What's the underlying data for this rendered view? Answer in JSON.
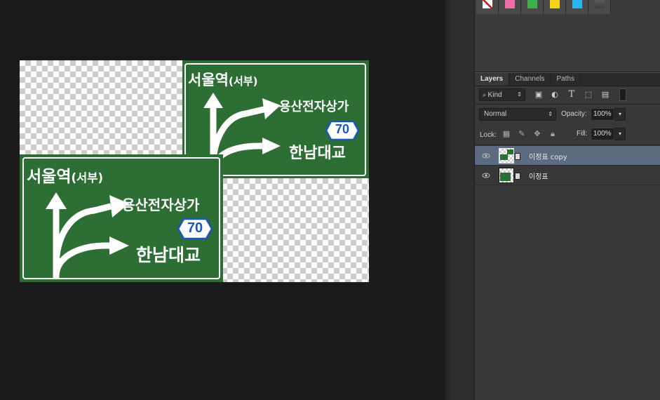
{
  "document": {
    "sign_front": {
      "top_line": "서울역",
      "top_line_sub": "(서부)",
      "middle_line": "용산전자상가",
      "route_number": "70",
      "bottom_line": "한남대교"
    },
    "sign_copy": {
      "top_line": "서울역",
      "top_line_sub": "(서부)",
      "middle_line": "용산전자상가",
      "route_number": "70",
      "bottom_line": "한남대교"
    }
  },
  "swatches": [
    {
      "name": "no-color",
      "color": "#ffffff"
    },
    {
      "name": "pink",
      "color": "#f06eaa"
    },
    {
      "name": "green",
      "color": "#3cb04a"
    },
    {
      "name": "yellow",
      "color": "#f7d21a"
    },
    {
      "name": "cyan",
      "color": "#29b6f0"
    },
    {
      "name": "gray",
      "color": "#4a4a4a"
    }
  ],
  "layers_panel": {
    "tabs": [
      "Layers",
      "Channels",
      "Paths"
    ],
    "filter_kind": "Kind",
    "blend_mode": "Normal",
    "opacity_label": "Opacity:",
    "opacity_value": "100%",
    "lock_label": "Lock:",
    "fill_label": "Fill:",
    "fill_value": "100%",
    "layers": [
      {
        "name": "이정표 copy",
        "selected": true,
        "visible": true
      },
      {
        "name": "이정표",
        "selected": false,
        "visible": true
      }
    ]
  }
}
